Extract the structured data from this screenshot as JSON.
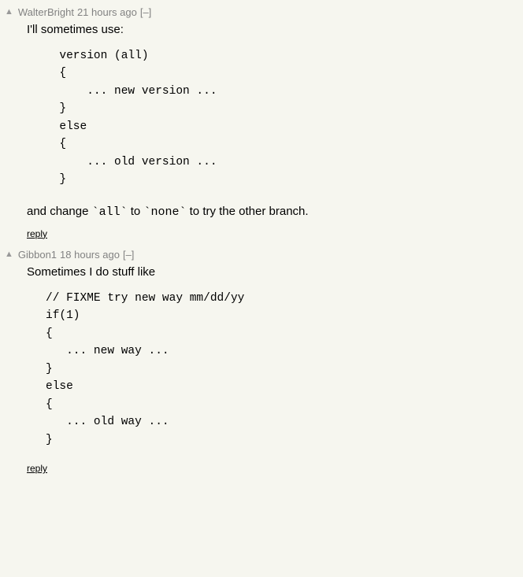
{
  "comments": [
    {
      "upvote_glyph": "▲",
      "username": "WalterBright",
      "age": "21 hours ago",
      "toggle": "[–]",
      "intro": "I'll sometimes use:",
      "code": "  version (all)\n  {\n      ... new version ...\n  }\n  else\n  {\n      ... old version ...\n  }",
      "outro_pre": "and change ",
      "outro_code1": "`all`",
      "outro_mid": " to ",
      "outro_code2": "`none`",
      "outro_post": " to try the other branch.",
      "reply_label": "reply"
    },
    {
      "upvote_glyph": "▲",
      "username": "Gibbon1",
      "age": "18 hours ago",
      "toggle": "[–]",
      "intro": "Sometimes I do stuff like",
      "code": "// FIXME try new way mm/dd/yy\nif(1)\n{\n   ... new way ...\n}\nelse\n{\n   ... old way ...\n}",
      "reply_label": "reply"
    }
  ]
}
